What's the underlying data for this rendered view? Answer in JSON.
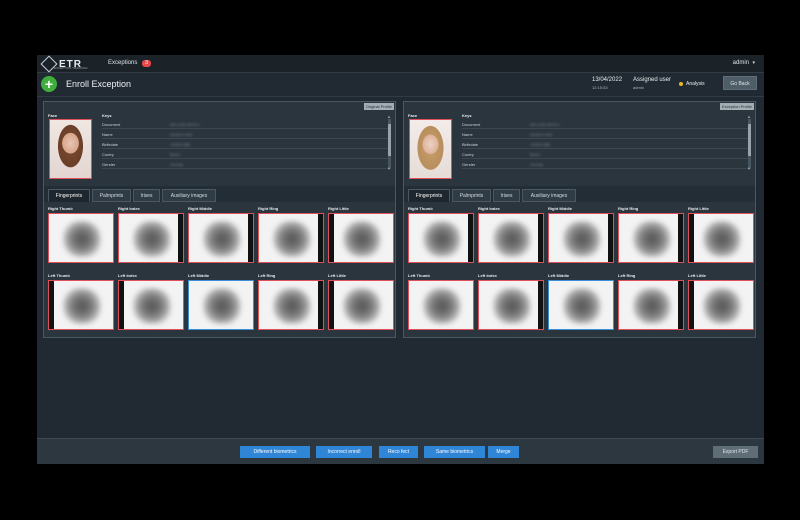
{
  "app": {
    "logo_text": "ETR",
    "logo_sub": "EXCEPTION TRACKING",
    "exceptions_label": "Exceptions",
    "exceptions_count": "3",
    "user": "admin",
    "user_caret": "▾"
  },
  "header": {
    "add_symbol": "+",
    "title": "Enroll Exception",
    "date": "13/04/2022",
    "time": "12:15:53",
    "assigned_label": "Assigned user",
    "assigned_value": "admin",
    "status_label": "Analysis",
    "status_color": "#e8b91c",
    "go_back": "Go Back"
  },
  "panels": [
    {
      "tag": "Original Profile",
      "face_label": "Face",
      "keys_label": "Keys",
      "keys": [
        {
          "name": "Document",
          "value": "AB-1234-5678-X"
        },
        {
          "name": "Name",
          "value": "Andrea Ortiz"
        },
        {
          "name": "Birthdate",
          "value": "12/06/1988"
        },
        {
          "name": "Contry",
          "value": "Brazil"
        },
        {
          "name": "Gender",
          "value": "Female"
        }
      ],
      "tabs": [
        "Fingerprints",
        "Palmprints",
        "Irises",
        "Auxiliary images"
      ],
      "fingers": [
        "Right Thumb",
        "Right Index",
        "Right Middle",
        "Right Ring",
        "Right Little",
        "Left Thumb",
        "Left Index",
        "Left Middle",
        "Left Ring",
        "Left Little"
      ]
    },
    {
      "tag": "Exception Profile",
      "face_label": "Face",
      "keys_label": "Keys",
      "keys": [
        {
          "name": "Document",
          "value": "AB-1234-5678-X"
        },
        {
          "name": "Name",
          "value": "Andrea Ortiz"
        },
        {
          "name": "Birthdate",
          "value": "12/06/1988"
        },
        {
          "name": "Contry",
          "value": "Brazil"
        },
        {
          "name": "Gender",
          "value": "Female"
        }
      ],
      "tabs": [
        "Fingerprints",
        "Palmprints",
        "Irises",
        "Auxiliary images"
      ],
      "fingers": [
        "Right Thumb",
        "Right Index",
        "Right Middle",
        "Right Ring",
        "Right Little",
        "Left Thumb",
        "Left Index",
        "Left Middle",
        "Left Ring",
        "Left Little"
      ]
    }
  ],
  "footer": {
    "b1": "Different biometrics",
    "b2": "Incorrect enroll",
    "b3": "Reco fect",
    "b4": "Same biometrics",
    "b5": "Merge",
    "export": "Export PDF"
  }
}
